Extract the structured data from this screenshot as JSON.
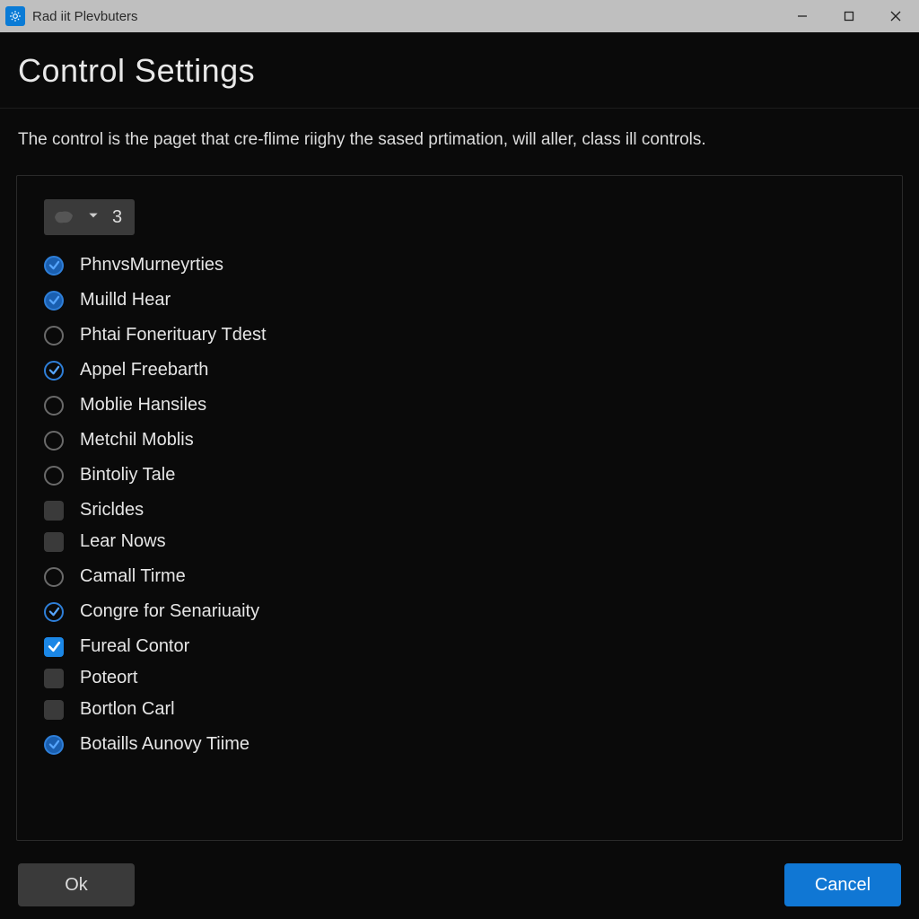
{
  "window": {
    "title": "Rad iit Plevbuters"
  },
  "page": {
    "heading": "Control Settings",
    "description": "The control is the paget that cre-flime riighy the sased prtimation, will aller, class ill controls."
  },
  "dropdown": {
    "value": "3"
  },
  "options": [
    {
      "kind": "radio",
      "checked": true,
      "style": "filled",
      "label": "PhnvsMurneyrties"
    },
    {
      "kind": "radio",
      "checked": true,
      "style": "filled",
      "label": "Muilld Hear"
    },
    {
      "kind": "radio",
      "checked": false,
      "style": "",
      "label": "Phtai Fonerituary Tdest"
    },
    {
      "kind": "radio",
      "checked": true,
      "style": "tick",
      "label": "Appel Freebarth"
    },
    {
      "kind": "radio",
      "checked": false,
      "style": "",
      "label": "Moblie Hansiles"
    },
    {
      "kind": "radio",
      "checked": false,
      "style": "",
      "label": "Metchil Moblis"
    },
    {
      "kind": "radio",
      "checked": false,
      "style": "",
      "label": "Bintoliy Tale"
    },
    {
      "kind": "checkbox",
      "checked": false,
      "style": "",
      "label": "Sricldes"
    },
    {
      "kind": "checkbox",
      "checked": false,
      "style": "",
      "label": "Lear Nows"
    },
    {
      "kind": "radio",
      "checked": false,
      "style": "",
      "label": "Camall Tirme"
    },
    {
      "kind": "radio",
      "checked": true,
      "style": "tick",
      "label": "Congre for Senariuaity"
    },
    {
      "kind": "checkbox",
      "checked": true,
      "style": "",
      "label": "Fureal Contor"
    },
    {
      "kind": "checkbox",
      "checked": false,
      "style": "",
      "label": "Poteort"
    },
    {
      "kind": "checkbox",
      "checked": false,
      "style": "",
      "label": "Bortlon Carl"
    },
    {
      "kind": "radio",
      "checked": true,
      "style": "filled",
      "label": "Botaills Aunovy Tiime"
    }
  ],
  "footer": {
    "ok": "Ok",
    "cancel": "Cancel"
  }
}
